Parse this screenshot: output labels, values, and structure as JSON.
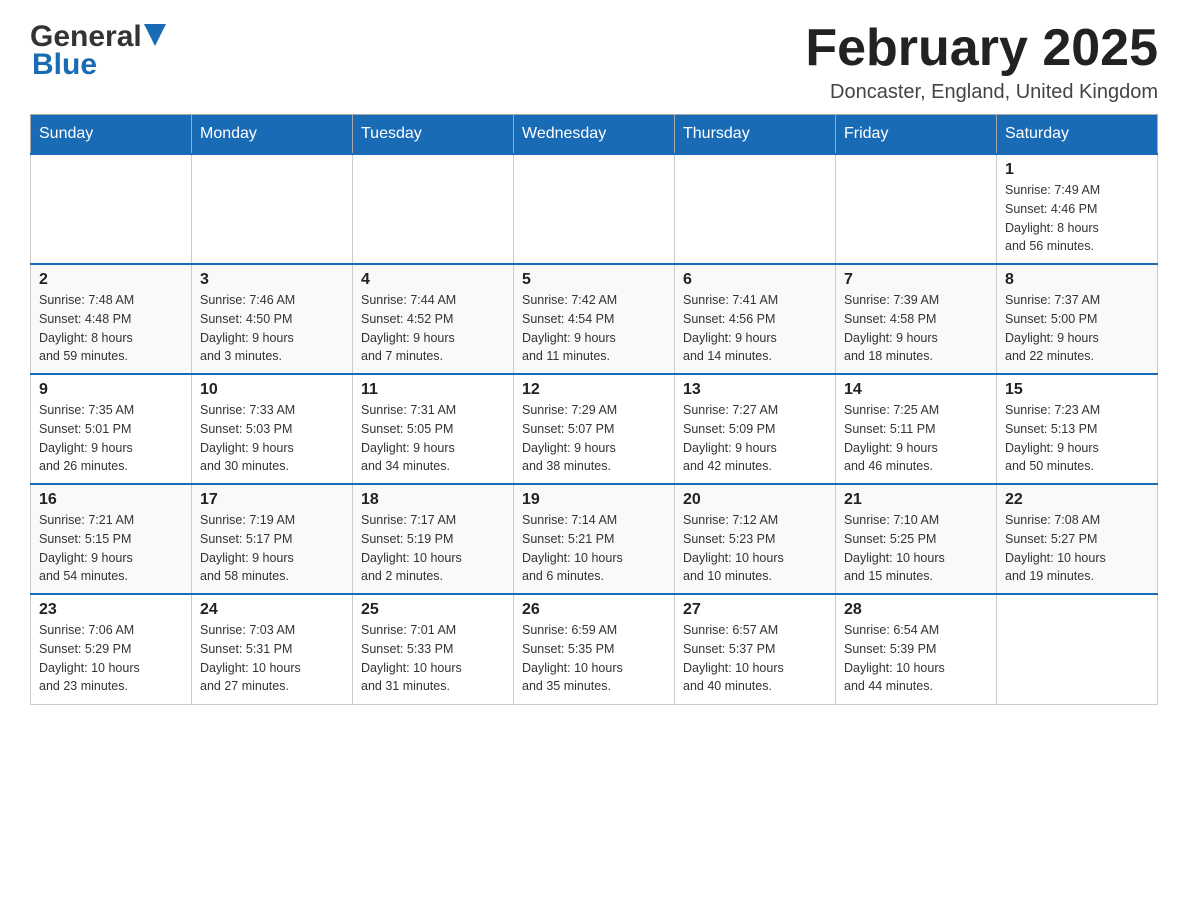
{
  "header": {
    "logo_general": "General",
    "logo_blue": "Blue",
    "month_title": "February 2025",
    "location": "Doncaster, England, United Kingdom"
  },
  "days_of_week": [
    "Sunday",
    "Monday",
    "Tuesday",
    "Wednesday",
    "Thursday",
    "Friday",
    "Saturday"
  ],
  "weeks": [
    [
      {
        "day": "",
        "info": ""
      },
      {
        "day": "",
        "info": ""
      },
      {
        "day": "",
        "info": ""
      },
      {
        "day": "",
        "info": ""
      },
      {
        "day": "",
        "info": ""
      },
      {
        "day": "",
        "info": ""
      },
      {
        "day": "1",
        "info": "Sunrise: 7:49 AM\nSunset: 4:46 PM\nDaylight: 8 hours\nand 56 minutes."
      }
    ],
    [
      {
        "day": "2",
        "info": "Sunrise: 7:48 AM\nSunset: 4:48 PM\nDaylight: 8 hours\nand 59 minutes."
      },
      {
        "day": "3",
        "info": "Sunrise: 7:46 AM\nSunset: 4:50 PM\nDaylight: 9 hours\nand 3 minutes."
      },
      {
        "day": "4",
        "info": "Sunrise: 7:44 AM\nSunset: 4:52 PM\nDaylight: 9 hours\nand 7 minutes."
      },
      {
        "day": "5",
        "info": "Sunrise: 7:42 AM\nSunset: 4:54 PM\nDaylight: 9 hours\nand 11 minutes."
      },
      {
        "day": "6",
        "info": "Sunrise: 7:41 AM\nSunset: 4:56 PM\nDaylight: 9 hours\nand 14 minutes."
      },
      {
        "day": "7",
        "info": "Sunrise: 7:39 AM\nSunset: 4:58 PM\nDaylight: 9 hours\nand 18 minutes."
      },
      {
        "day": "8",
        "info": "Sunrise: 7:37 AM\nSunset: 5:00 PM\nDaylight: 9 hours\nand 22 minutes."
      }
    ],
    [
      {
        "day": "9",
        "info": "Sunrise: 7:35 AM\nSunset: 5:01 PM\nDaylight: 9 hours\nand 26 minutes."
      },
      {
        "day": "10",
        "info": "Sunrise: 7:33 AM\nSunset: 5:03 PM\nDaylight: 9 hours\nand 30 minutes."
      },
      {
        "day": "11",
        "info": "Sunrise: 7:31 AM\nSunset: 5:05 PM\nDaylight: 9 hours\nand 34 minutes."
      },
      {
        "day": "12",
        "info": "Sunrise: 7:29 AM\nSunset: 5:07 PM\nDaylight: 9 hours\nand 38 minutes."
      },
      {
        "day": "13",
        "info": "Sunrise: 7:27 AM\nSunset: 5:09 PM\nDaylight: 9 hours\nand 42 minutes."
      },
      {
        "day": "14",
        "info": "Sunrise: 7:25 AM\nSunset: 5:11 PM\nDaylight: 9 hours\nand 46 minutes."
      },
      {
        "day": "15",
        "info": "Sunrise: 7:23 AM\nSunset: 5:13 PM\nDaylight: 9 hours\nand 50 minutes."
      }
    ],
    [
      {
        "day": "16",
        "info": "Sunrise: 7:21 AM\nSunset: 5:15 PM\nDaylight: 9 hours\nand 54 minutes."
      },
      {
        "day": "17",
        "info": "Sunrise: 7:19 AM\nSunset: 5:17 PM\nDaylight: 9 hours\nand 58 minutes."
      },
      {
        "day": "18",
        "info": "Sunrise: 7:17 AM\nSunset: 5:19 PM\nDaylight: 10 hours\nand 2 minutes."
      },
      {
        "day": "19",
        "info": "Sunrise: 7:14 AM\nSunset: 5:21 PM\nDaylight: 10 hours\nand 6 minutes."
      },
      {
        "day": "20",
        "info": "Sunrise: 7:12 AM\nSunset: 5:23 PM\nDaylight: 10 hours\nand 10 minutes."
      },
      {
        "day": "21",
        "info": "Sunrise: 7:10 AM\nSunset: 5:25 PM\nDaylight: 10 hours\nand 15 minutes."
      },
      {
        "day": "22",
        "info": "Sunrise: 7:08 AM\nSunset: 5:27 PM\nDaylight: 10 hours\nand 19 minutes."
      }
    ],
    [
      {
        "day": "23",
        "info": "Sunrise: 7:06 AM\nSunset: 5:29 PM\nDaylight: 10 hours\nand 23 minutes."
      },
      {
        "day": "24",
        "info": "Sunrise: 7:03 AM\nSunset: 5:31 PM\nDaylight: 10 hours\nand 27 minutes."
      },
      {
        "day": "25",
        "info": "Sunrise: 7:01 AM\nSunset: 5:33 PM\nDaylight: 10 hours\nand 31 minutes."
      },
      {
        "day": "26",
        "info": "Sunrise: 6:59 AM\nSunset: 5:35 PM\nDaylight: 10 hours\nand 35 minutes."
      },
      {
        "day": "27",
        "info": "Sunrise: 6:57 AM\nSunset: 5:37 PM\nDaylight: 10 hours\nand 40 minutes."
      },
      {
        "day": "28",
        "info": "Sunrise: 6:54 AM\nSunset: 5:39 PM\nDaylight: 10 hours\nand 44 minutes."
      },
      {
        "day": "",
        "info": ""
      }
    ]
  ]
}
